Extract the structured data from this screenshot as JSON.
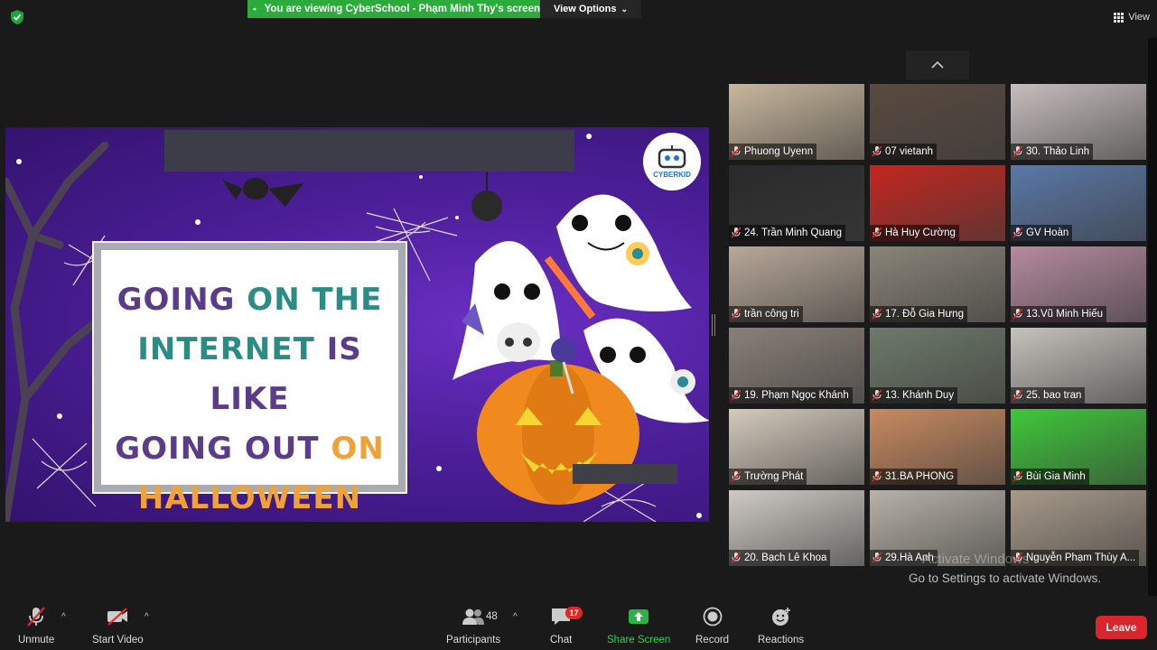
{
  "banner": {
    "viewing_text": "You are viewing CyberSchool - Phạm Minh Thy's screen",
    "view_options": "View Options"
  },
  "view_button": "View",
  "slide": {
    "line1a": "GOING ",
    "line1b": "ON THE",
    "line2a": "INTERNET ",
    "line2b": "IS LIKE",
    "line3a": "GOING OUT ",
    "line3b": "ON",
    "line4": "HALLOWEEN",
    "logo_text": "CYBERKID",
    "colors": {
      "purple": "#5b3c8a",
      "teal": "#2b8c86",
      "orange": "#f0a236",
      "bg": "#4d1f9a"
    }
  },
  "participants_grid": [
    {
      "name": "Phuong Uyenn",
      "bg": "#c9b79d"
    },
    {
      "name": "07 vietanh",
      "bg": "#5a4a40"
    },
    {
      "name": "30. Thảo Linh",
      "bg": "#c7bebd"
    },
    {
      "name": "24. Trần Minh Quang",
      "bg": "#2a2a2a"
    },
    {
      "name": "Hà Huy Cường",
      "bg": "#c4261f"
    },
    {
      "name": "GV Hoàn",
      "bg": "#5a78a8"
    },
    {
      "name": "trần công tri",
      "bg": "#b8a898"
    },
    {
      "name": "17. Đỗ Gia Hưng",
      "bg": "#8a8478"
    },
    {
      "name": "13.Vũ Minh Hiếu",
      "bg": "#b58aa0"
    },
    {
      "name": "19. Phạm Ngọc Khánh",
      "bg": "#8a8078"
    },
    {
      "name": "13. Khánh Duy",
      "bg": "#6e7a6a"
    },
    {
      "name": "25. bao tran",
      "bg": "#c6c2bc"
    },
    {
      "name": "Trường Phát",
      "bg": "#d4cabc"
    },
    {
      "name": "31.BA PHONG",
      "bg": "#c98a60"
    },
    {
      "name": "Bùi Gia Minh",
      "bg": "#3ec83a"
    },
    {
      "name": "20. Bạch Lê Khoa",
      "bg": "#cfcac4"
    },
    {
      "name": "29.Hà Anh",
      "bg": "#b8b2a8"
    },
    {
      "name": "Nguyễn Phạm Thùy A...",
      "bg": "#a89a8a"
    }
  ],
  "watermark": {
    "line1": "Activate Windows",
    "line2": "Go to Settings to activate Windows."
  },
  "toolbar": {
    "unmute": "Unmute",
    "start_video": "Start Video",
    "participants": "Participants",
    "participants_count": "48",
    "chat": "Chat",
    "chat_badge": "17",
    "share_screen": "Share Screen",
    "record": "Record",
    "reactions": "Reactions",
    "leave": "Leave"
  }
}
